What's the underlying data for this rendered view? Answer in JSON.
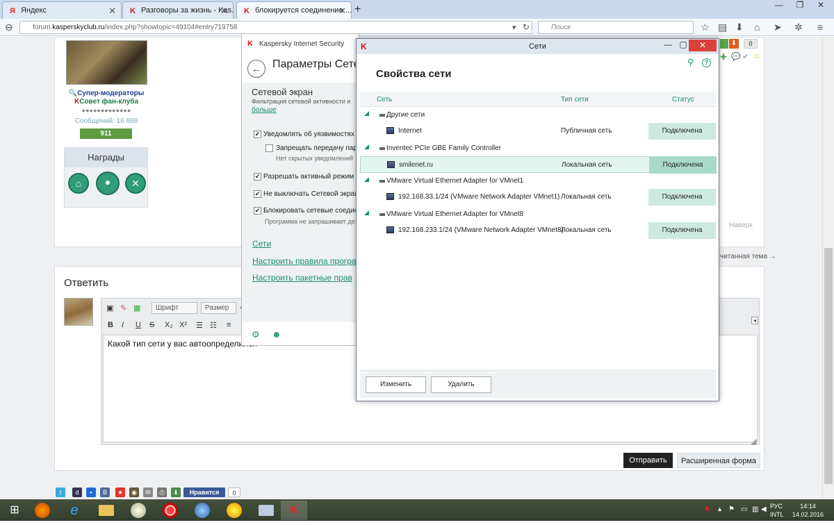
{
  "browser": {
    "tabs": [
      {
        "label": "Яндекс",
        "icon": "yandex-icon"
      },
      {
        "label": "Разговоры за жизнь - Kas...",
        "icon": "kaspersky-icon"
      },
      {
        "label": "блокируется соединение ...",
        "icon": "kaspersky-icon"
      }
    ],
    "url_prefix": "forum.",
    "url_domain": "kasperskyclub.ru",
    "url_path": "/index.php?showtopic=49104#entry719758",
    "search_placeholder": "Поиск"
  },
  "forum": {
    "user_group": "Супер-модераторы",
    "user_council": "Совет фан-клуба",
    "dots": "●●●●●●●●●●●●●",
    "messages": "Сообщений: 16 888",
    "rep": "911",
    "awards_title": "Награды",
    "up_link": "Наверх",
    "unread_link": "читанная тема →",
    "reply_title": "Ответить",
    "font_select": "Шрифт",
    "size_select": "Размер",
    "editor_text": "Какой тип сети у вас автоопределился",
    "send_button": "Отправить",
    "extended_button": "Расширенная форма",
    "like_button": "Нравится",
    "like_count": "0",
    "toolbar_counter": "0"
  },
  "kis": {
    "app_title": "Kaspersky Internet Security",
    "page_title": "Параметры Сетевого",
    "section": "Сетевой экран",
    "section_desc": "Фильтрация сетевой активности и",
    "more_link": "больше",
    "options": [
      {
        "label": "Уведомлять об уязвимостях пр",
        "checked": true
      },
      {
        "label": "Запрещать передачу паро",
        "checked": false
      },
      {
        "label": "Разрешать активный режим FT",
        "checked": true
      },
      {
        "label": "Не выключать Сетевой экран д",
        "checked": true
      },
      {
        "label": "Блокировать сетевые соедине",
        "checked": true
      }
    ],
    "hint1": "Нет скрытых уведомлений",
    "hint2": "Программа не запрашивает де",
    "links": [
      "Сети",
      "Настроить правила програ",
      "Настроить пакетные прав"
    ]
  },
  "networks": {
    "window_title": "Сети",
    "heading": "Свойства сети",
    "columns": {
      "name": "Сеть",
      "type": "Тип сети",
      "status": "Статус"
    },
    "groups": [
      {
        "name": "Другие сети",
        "rows": [
          {
            "name": "Internet",
            "type": "Публичная сеть",
            "status": "Подключена",
            "selected": false
          }
        ]
      },
      {
        "name": "Inventec PCIe GBE Family Controller",
        "rows": [
          {
            "name": "smilenet.ru",
            "type": "Локальная сеть",
            "status": "Подключена",
            "selected": true
          }
        ]
      },
      {
        "name": "VMware Virtual Ethernet Adapter for VMnet1",
        "rows": [
          {
            "name": "192.168.33.1/24 (VMware Network Adapter VMnet1)",
            "type": "Локальная сеть",
            "status": "Подключена",
            "selected": false
          }
        ]
      },
      {
        "name": "VMware Virtual Ethernet Adapter for VMnet8",
        "rows": [
          {
            "name": "192.168.233.1/24 (VMware Network Adapter VMnet8)",
            "type": "Локальная сеть",
            "status": "Подключена",
            "selected": false
          }
        ]
      }
    ],
    "edit_button": "Изменить",
    "delete_button": "Удалить"
  },
  "taskbar": {
    "lang": "РУС",
    "layout": "INTL",
    "time": "14:14",
    "date": "14.02.2016"
  },
  "colors": {
    "accent": "#1a8a72",
    "status_bg": "#cde9e0",
    "close": "#d9413a"
  }
}
